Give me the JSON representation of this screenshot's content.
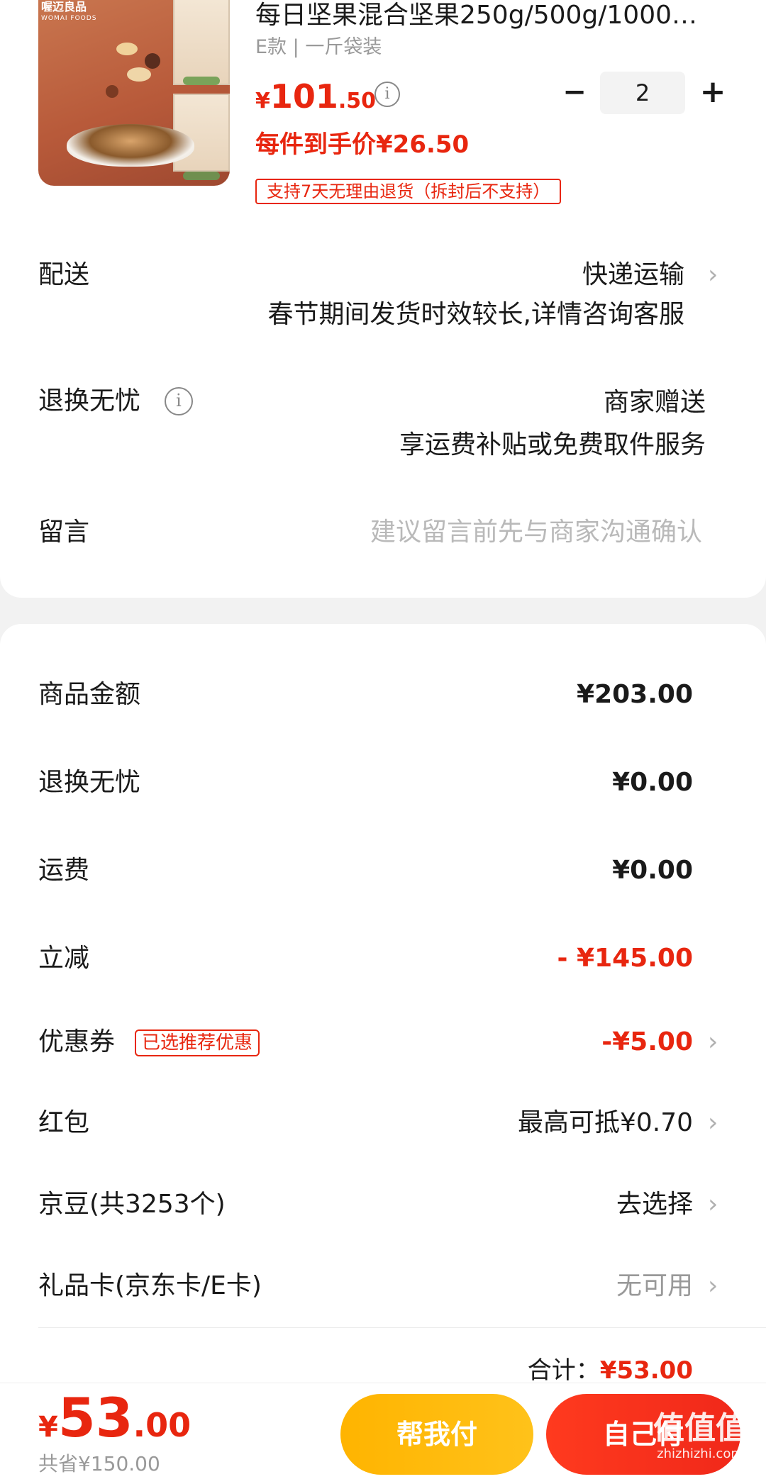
{
  "product": {
    "title": "每日坚果混合坚果250g/500g/1000…",
    "spec": "E款 | 一斤袋装",
    "price_currency": "¥",
    "price_int": "101",
    "price_dec": ".50",
    "quantity": "2",
    "unit_price_text": "每件到手价¥26.50",
    "return_badge": "支持7天无理由退货（拆封后不支持）",
    "image_brand": "喔迈良品",
    "image_brand_en": "WOMAI FOODS"
  },
  "delivery": {
    "label": "配送",
    "method": "快递运输",
    "note": "春节期间发货时效较长,详情咨询客服"
  },
  "return_service": {
    "label": "退换无忧",
    "value": "商家赠送",
    "note": "享运费补贴或免费取件服务"
  },
  "message": {
    "label": "留言",
    "placeholder": "建议留言前先与商家沟通确认"
  },
  "summary": {
    "goods_amount_label": "商品金额",
    "goods_amount": "¥203.00",
    "return_label": "退换无忧",
    "return_amount": "¥0.00",
    "shipping_label": "运费",
    "shipping_amount": "¥0.00",
    "discount_label": "立减",
    "discount_amount": "- ¥145.00",
    "coupon_label": "优惠券",
    "coupon_tag": "已选推荐优惠",
    "coupon_amount": "-¥5.00",
    "redpacket_label": "红包",
    "redpacket_value": "最高可抵¥0.70",
    "jingdou_label": "京豆(共3253个)",
    "jingdou_value": "去选择",
    "giftcard_label": "礼品卡(京东卡/E卡)",
    "giftcard_value": "无可用",
    "total_label": "合计：",
    "total_value": "¥53.00"
  },
  "bottom": {
    "currency": "¥",
    "total_int": "53",
    "total_dec": ".00",
    "saved": "共省¥150.00",
    "help_pay": "帮我付",
    "self_pay": "自己付",
    "watermark": "值值值",
    "watermark_url": "zhizhizhi.com"
  },
  "colors": {
    "accent_red": "#e8260f",
    "help_button": "#ffb400",
    "pay_button": "#f0281a"
  }
}
